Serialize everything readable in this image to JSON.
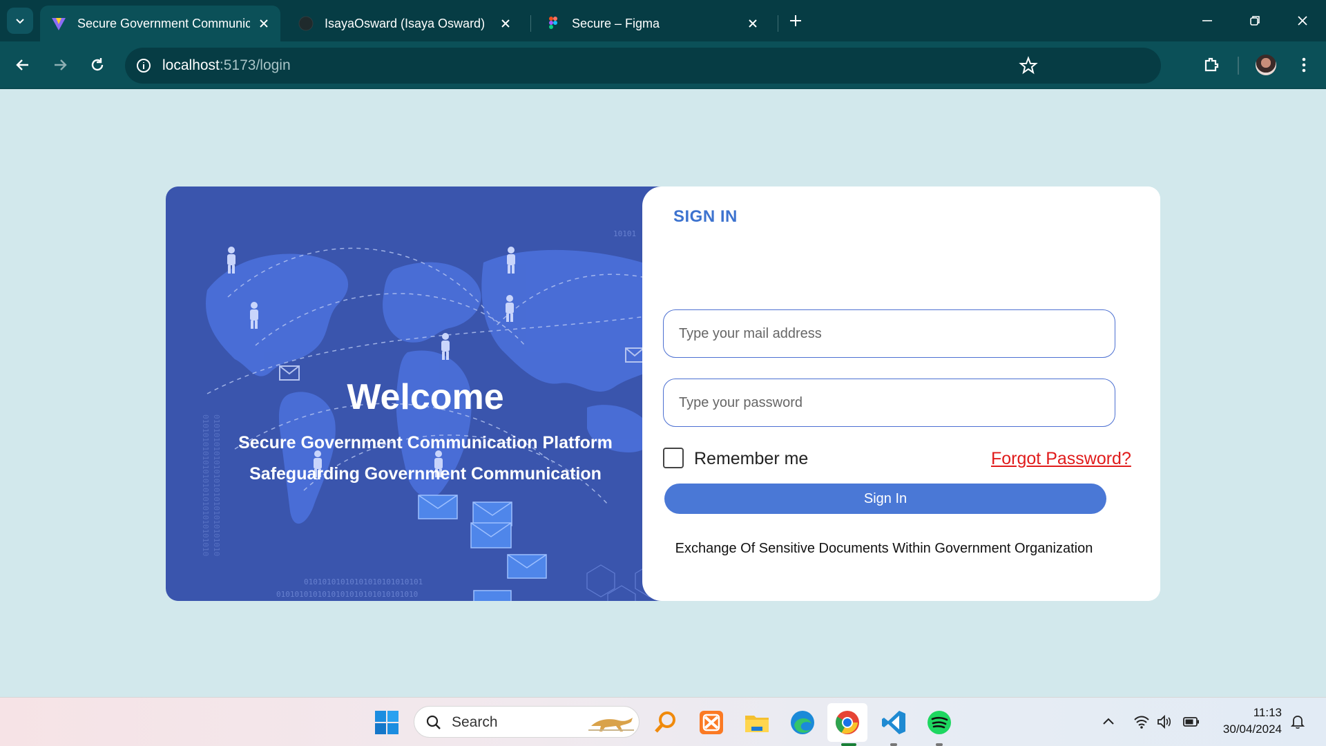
{
  "browser": {
    "tabs": [
      {
        "title": "Secure Government Communic",
        "icon": "vite-icon",
        "active": true
      },
      {
        "title": "IsayaOsward (Isaya Osward)",
        "icon": "github-icon",
        "active": false
      },
      {
        "title": "Secure – Figma",
        "icon": "figma-icon",
        "active": false
      }
    ],
    "url_host": "localhost",
    "url_path": ":5173/login"
  },
  "panel": {
    "welcome": "Welcome",
    "tagline1": "Secure Government Communication Platform",
    "tagline2": "Safeguarding Government Communication",
    "binary_a": "01010101010101010101010101",
    "binary_b": "0101010101010101010101010101010",
    "binary_c": "10101"
  },
  "login": {
    "title": "SIGN IN",
    "email_placeholder": "Type your mail address",
    "password_placeholder": "Type your password",
    "remember_label": "Remember me",
    "remember_checked": false,
    "forgot_label": "Forgot Password?",
    "signin_label": "Sign In",
    "footnote": "Exchange Of Sensitive Documents Within Government Organization"
  },
  "colors": {
    "browser_dark": "#063c44",
    "browser_mid": "#0b5058",
    "page_bg": "#d2e8ec",
    "panel_blue": "#3a55ad",
    "accent_blue": "#4a78d6",
    "forgot_red": "#e01b1b"
  },
  "taskbar": {
    "search_label": "Search",
    "time": "11:13",
    "date": "30/04/2024",
    "apps": [
      "windows-start-icon",
      "search-icon",
      "magnifier-app-icon",
      "xampp-icon",
      "file-explorer-icon",
      "edge-icon",
      "chrome-icon",
      "vscode-icon",
      "spotify-icon"
    ]
  }
}
